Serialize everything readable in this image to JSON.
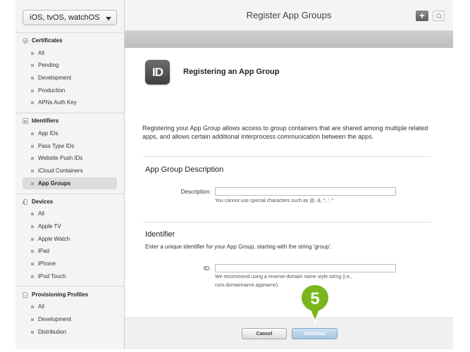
{
  "sidebar": {
    "platform": "iOS, tvOS, watchOS",
    "sections": [
      {
        "title": "Certificates",
        "icon": "certificate-icon",
        "items": [
          "All",
          "Pending",
          "Development",
          "Production",
          "APNs Auth Key"
        ]
      },
      {
        "title": "Identifiers",
        "icon": "id-icon",
        "items": [
          "App IDs",
          "Pass Type IDs",
          "Website Push IDs",
          "iCloud Containers",
          "App Groups"
        ]
      },
      {
        "title": "Devices",
        "icon": "device-icon",
        "items": [
          "All",
          "Apple TV",
          "Apple Watch",
          "iPad",
          "iPhone",
          "iPod Touch"
        ]
      },
      {
        "title": "Provisioning Profiles",
        "icon": "document-icon",
        "items": [
          "All",
          "Development",
          "Distribution"
        ]
      }
    ],
    "active_item": "App Groups"
  },
  "header": {
    "title": "Register App Groups",
    "add_label": "+"
  },
  "main": {
    "badge": "ID",
    "heading": "Registering an App Group",
    "intro": "Registering your App Group allows access to group containers that are shared among multiple related apps, and allows certain additional interprocess communication between the apps.",
    "description_section": {
      "title": "App Group Description",
      "label": "Description:",
      "value": "",
      "hint": "You cannot use special characters such as @, &, *, ', \""
    },
    "identifier_section": {
      "title": "Identifier",
      "desc": "Enter a unique identifier for your App Group, starting with the string 'group'.",
      "label": "ID:",
      "value": "",
      "hint_line1": "We recommend using a reverse-domain name style string (i.e.,",
      "hint_line2": "com.domainname.appname)."
    }
  },
  "footer": {
    "cancel": "Cancel",
    "continue": "Continue"
  },
  "callout": {
    "step": "5",
    "color": "#7ab51d"
  }
}
